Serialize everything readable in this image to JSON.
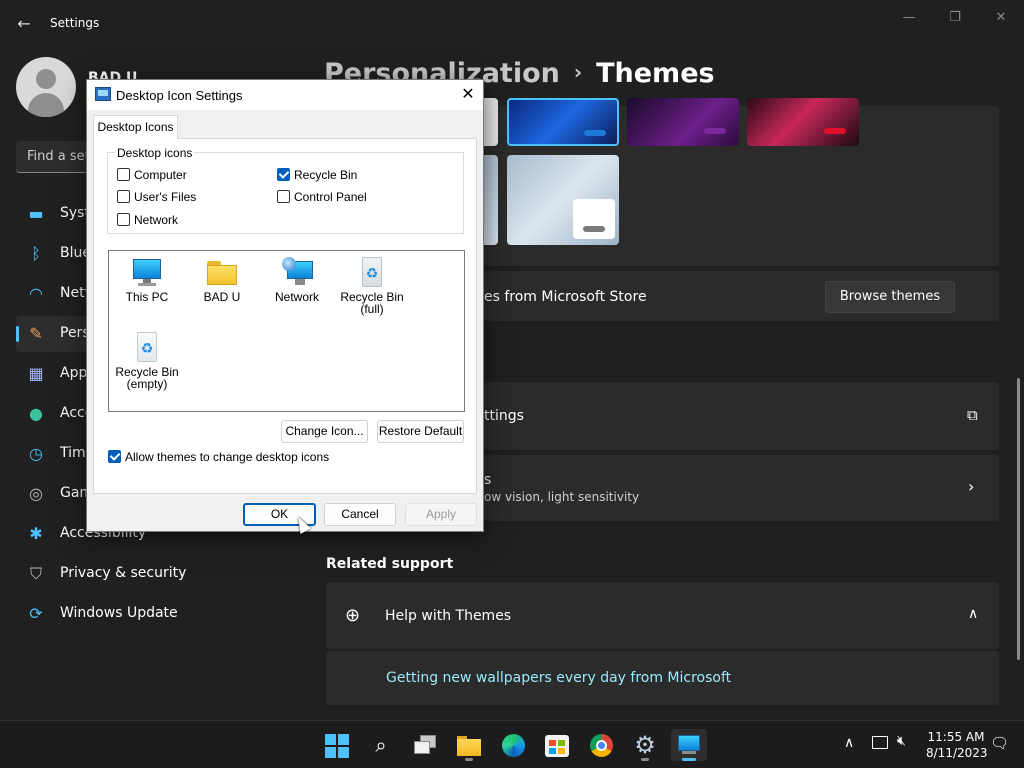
{
  "window": {
    "back_glyph": "←",
    "title": "Settings",
    "minimize_glyph": "—",
    "maximize_glyph": "❐",
    "close_glyph": "✕"
  },
  "user": {
    "name": "BAD U"
  },
  "search": {
    "placeholder": "Find a set"
  },
  "sidebar": {
    "items": [
      {
        "label": "Syste",
        "icon": "system-icon",
        "glyph": "▬",
        "color": "#4cc2ff"
      },
      {
        "label": "Blue",
        "icon": "bluetooth-icon",
        "glyph": "ᛒ",
        "color": "#4cc2ff"
      },
      {
        "label": "Netw",
        "icon": "wifi-icon",
        "glyph": "◠",
        "color": "#4cc2ff"
      },
      {
        "label": "Pers",
        "icon": "brush-icon",
        "glyph": "✎",
        "color": "#e8a055"
      },
      {
        "label": "App",
        "icon": "apps-icon",
        "glyph": "▦",
        "color": "#a7b8ff"
      },
      {
        "label": "Acco",
        "icon": "account-icon",
        "glyph": "●",
        "color": "#3cc29a"
      },
      {
        "label": "Time",
        "icon": "clock-icon",
        "glyph": "◷",
        "color": "#4cc2ff"
      },
      {
        "label": "Gam",
        "icon": "gamepad-icon",
        "glyph": "◎",
        "color": "#bdbdbd"
      },
      {
        "label": "Accessibility",
        "icon": "accessibility-icon",
        "glyph": "✱",
        "color": "#4cc2ff"
      },
      {
        "label": "Privacy & security",
        "icon": "shield-icon",
        "glyph": "⛉",
        "color": "#bdbdbd"
      },
      {
        "label": "Windows Update",
        "icon": "update-icon",
        "glyph": "⟳",
        "color": "#4cc2ff"
      }
    ],
    "active_index": 3
  },
  "breadcrumb": {
    "parent": "Personalization",
    "separator": "›",
    "current": "Themes"
  },
  "themes_store": {
    "text": "es from Microsoft Store",
    "button": "Browse themes"
  },
  "rows": {
    "desktop_icon_settings": "ttings",
    "contrast_sub": "ow vision, light sensitivity",
    "contrast_title": "s"
  },
  "related_support": {
    "heading": "Related support",
    "help_title": "Help with Themes",
    "link": "Getting new wallpapers every day from Microsoft"
  },
  "dialog": {
    "title": "Desktop Icon Settings",
    "close_glyph": "✕",
    "tab": "Desktop Icons",
    "group_label": "Desktop icons",
    "checkboxes": {
      "computer": {
        "label": "Computer",
        "checked": false
      },
      "recycle_bin": {
        "label": "Recycle Bin",
        "checked": true
      },
      "users_files": {
        "label": "User's Files",
        "checked": false
      },
      "control_panel": {
        "label": "Control Panel",
        "checked": false
      },
      "network": {
        "label": "Network",
        "checked": false
      }
    },
    "icons": [
      {
        "label": "This PC",
        "icon": "this-pc-icon"
      },
      {
        "label": "BAD U",
        "icon": "user-folder-icon"
      },
      {
        "label": "Network",
        "icon": "network-icon"
      },
      {
        "label": "Recycle Bin\n(full)",
        "icon": "recycle-bin-full-icon"
      },
      {
        "label": "Recycle Bin\n(empty)",
        "icon": "recycle-bin-empty-icon"
      }
    ],
    "change_icon": "Change Icon...",
    "restore_default": "Restore Default",
    "allow_themes": {
      "label": "Allow themes to change desktop icons",
      "checked": true
    },
    "ok": "OK",
    "cancel": "Cancel",
    "apply": "Apply"
  },
  "taskbar": {
    "items": [
      "start-icon",
      "search-icon",
      "task-view-icon",
      "file-explorer-icon",
      "edge-icon",
      "store-icon",
      "chrome-icon",
      "settings-icon",
      "remote-desktop-icon"
    ],
    "active_index": 8
  },
  "tray": {
    "chevron_glyph": "∧",
    "time": "11:55 AM",
    "date": "8/11/2023"
  },
  "colors": {
    "accent": "#4cc2ff",
    "link": "#99ebff",
    "dialog_accent": "#005fb8"
  }
}
